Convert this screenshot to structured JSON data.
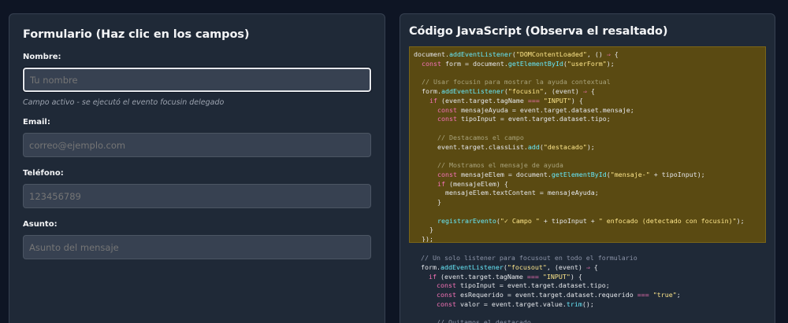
{
  "form_panel": {
    "title": "Formulario (Haz clic en los campos)",
    "fields": [
      {
        "label": "Nombre:",
        "placeholder": "Tu nombre",
        "hint": "Campo activo - se ejecutó el evento focusin delegado"
      },
      {
        "label": "Email:",
        "placeholder": "correo@ejemplo.com"
      },
      {
        "label": "Teléfono:",
        "placeholder": "123456789"
      },
      {
        "label": "Asunto:",
        "placeholder": "Asunto del mensaje"
      }
    ]
  },
  "code_panel": {
    "title": "Código JavaScript (Observa el resaltado)",
    "highlighted_lines": [
      "document.addEventListener(\"DOMContentLoaded\", () ⇒ {",
      "  const form = document.getElementById(\"userForm\");",
      "",
      "  // Usar focusin para mostrar la ayuda contextual",
      "  form.addEventListener(\"focusin\", (event) ⇒ {",
      "    if (event.target.tagName === \"INPUT\") {",
      "      const mensajeAyuda = event.target.dataset.mensaje;",
      "      const tipoInput = event.target.dataset.tipo;",
      "",
      "      // Destacamos el campo",
      "      event.target.classList.add(\"destacado\");",
      "",
      "      // Mostramos el mensaje de ayuda",
      "      const mensajeElem = document.getElementById(\"mensaje-\" + tipoInput);",
      "      if (mensajeElem) {",
      "        mensajeElem.textContent = mensajeAyuda;",
      "      }",
      "",
      "      registrarEvento(\"✓ Campo \" + tipoInput + \" enfocado (detectado con focusin)\");",
      "    }",
      "  });"
    ],
    "rest_lines": [
      "  // Un solo listener para focusout en todo el formulario",
      "  form.addEventListener(\"focusout\", (event) ⇒ {",
      "    if (event.target.tagName === \"INPUT\") {",
      "      const tipoInput = event.target.dataset.tipo;",
      "      const esRequerido = event.target.dataset.requerido === \"true\";",
      "      const valor = event.target.value.trim();",
      "",
      "      // Quitamos el destacado"
    ]
  },
  "colors": {
    "background": "#0e1524",
    "panel": "#1f2937",
    "highlight": "#5a4a12",
    "keyword": "#f472b6",
    "function": "#67e8f9",
    "string": "#fde68a",
    "comment": "#8b93a7"
  }
}
